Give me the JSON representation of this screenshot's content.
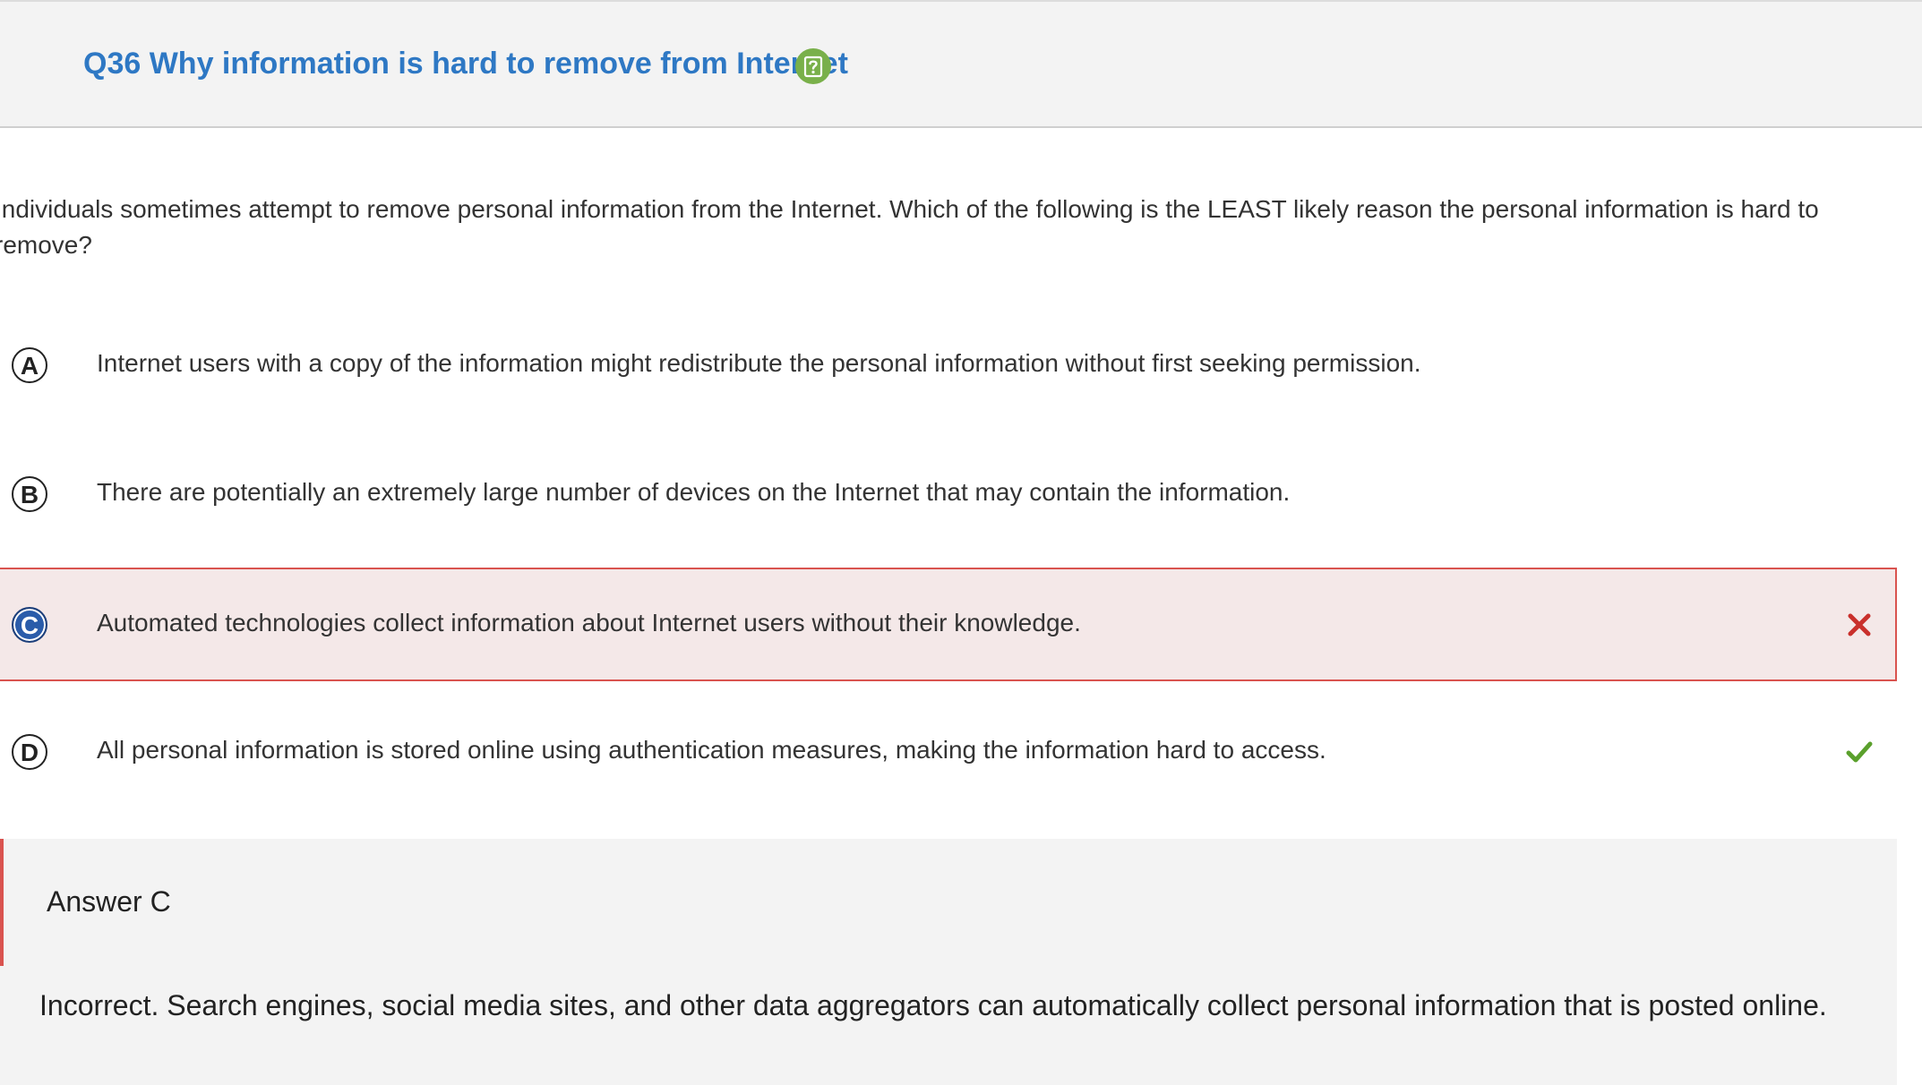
{
  "header": {
    "title": "Q36 Why information is hard to remove from Internet",
    "help_icon": "question-mark-icon",
    "title_color": "#2e78c4",
    "help_icon_color": "#79b04a"
  },
  "question": {
    "prompt": "Individuals sometimes attempt to remove personal information from the Internet. Which of the following is the LEAST likely reason the personal information is hard to remove?"
  },
  "options": [
    {
      "letter": "A",
      "text": "Internet users with a copy of the information might redistribute the personal information without first seeking permission."
    },
    {
      "letter": "B",
      "text": "There are potentially an extremely large number of devices on the Internet that may contain the information."
    },
    {
      "letter": "C",
      "text": "Automated technologies collect information about Internet users without their knowledge.",
      "selected": true,
      "status": "incorrect",
      "status_icon": "x-icon",
      "status_color": "#c9302c"
    },
    {
      "letter": "D",
      "text": "All personal information is stored online using authentication measures, making the information hard to access.",
      "status": "correct",
      "status_icon": "checkmark-icon",
      "status_color": "#5aa02c"
    }
  ],
  "feedback": {
    "answer_label": "Answer C",
    "explanation": "Incorrect. Search engines, social media sites, and other data aggregators can automatically collect personal information that is posted online.",
    "accent_color": "#d9534f"
  }
}
